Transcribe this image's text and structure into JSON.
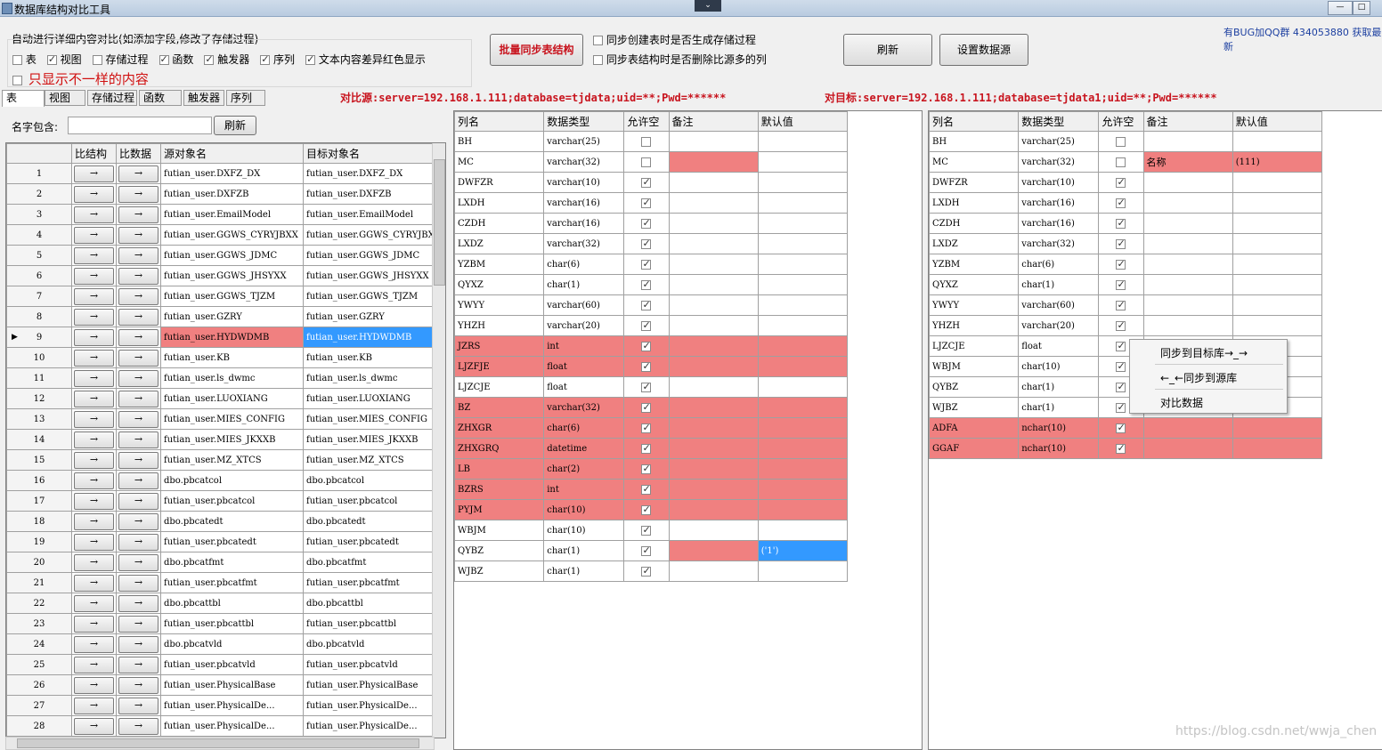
{
  "window": {
    "title": "数据库结构对比工具",
    "collapse_glyph": "⌄"
  },
  "options": {
    "auto_compare_label": "自动进行详细内容对比(如添加字段,修改了存储过程)",
    "checks": [
      {
        "label": "表",
        "checked": false
      },
      {
        "label": "视图",
        "checked": true
      },
      {
        "label": "存储过程",
        "checked": false
      },
      {
        "label": "函数",
        "checked": true
      },
      {
        "label": "触发器",
        "checked": true
      },
      {
        "label": "序列",
        "checked": true
      },
      {
        "label": "文本内容差异红色显示",
        "checked": true
      }
    ],
    "only_diff_label": "只显示不一样的内容",
    "batch_sync_label": "批量同步表结构",
    "sync_create_proc_label": "同步创建表时是否生成存储过程",
    "sync_delete_cols_label": "同步表结构时是否删除比源多的列",
    "refresh_label": "刷新",
    "set_datasource_label": "设置数据源",
    "bug_text": "有BUG加QQ群 434053880 获取最新"
  },
  "tabs": [
    "表",
    "视图",
    "存储过程",
    "函数",
    "触发器",
    "序列"
  ],
  "source_label": "对比源:server=192.168.1.111;database=tjdata;uid=**;Pwd=******",
  "target_label": "对目标:server=192.168.1.111;database=tjdata1;uid=**;Pwd=******",
  "filter": {
    "label": "名字包含:",
    "value": "",
    "refresh_label": "刷新"
  },
  "object_list": {
    "headers": [
      "比结构",
      "比数据",
      "源对象名",
      "目标对象名"
    ],
    "arrow": "→",
    "rows": [
      {
        "n": "1",
        "src": "futian_user.DXFZ_DX",
        "dst": "futian_user.DXFZ_DX"
      },
      {
        "n": "2",
        "src": "futian_user.DXFZB",
        "dst": "futian_user.DXFZB"
      },
      {
        "n": "3",
        "src": "futian_user.EmailModel",
        "dst": "futian_user.EmailModel"
      },
      {
        "n": "4",
        "src": "futian_user.GGWS_CYRYJBXX",
        "dst": "futian_user.GGWS_CYRYJBX"
      },
      {
        "n": "5",
        "src": "futian_user.GGWS_JDMC",
        "dst": "futian_user.GGWS_JDMC"
      },
      {
        "n": "6",
        "src": "futian_user.GGWS_JHSYXX",
        "dst": "futian_user.GGWS_JHSYXX"
      },
      {
        "n": "7",
        "src": "futian_user.GGWS_TJZM",
        "dst": "futian_user.GGWS_TJZM"
      },
      {
        "n": "8",
        "src": "futian_user.GZRY",
        "dst": "futian_user.GZRY"
      },
      {
        "n": "9",
        "src": "futian_user.HYDWDMB",
        "dst": "futian_user.HYDWDMB",
        "selected": true
      },
      {
        "n": "10",
        "src": "futian_user.KB",
        "dst": "futian_user.KB"
      },
      {
        "n": "11",
        "src": "futian_user.ls_dwmc",
        "dst": "futian_user.ls_dwmc"
      },
      {
        "n": "12",
        "src": "futian_user.LUOXIANG",
        "dst": "futian_user.LUOXIANG"
      },
      {
        "n": "13",
        "src": "futian_user.MIES_CONFIG",
        "dst": "futian_user.MIES_CONFIG"
      },
      {
        "n": "14",
        "src": "futian_user.MIES_JKXXB",
        "dst": "futian_user.MIES_JKXXB"
      },
      {
        "n": "15",
        "src": "futian_user.MZ_XTCS",
        "dst": "futian_user.MZ_XTCS"
      },
      {
        "n": "16",
        "src": "dbo.pbcatcol",
        "dst": "dbo.pbcatcol"
      },
      {
        "n": "17",
        "src": "futian_user.pbcatcol",
        "dst": "futian_user.pbcatcol"
      },
      {
        "n": "18",
        "src": "dbo.pbcatedt",
        "dst": "dbo.pbcatedt"
      },
      {
        "n": "19",
        "src": "futian_user.pbcatedt",
        "dst": "futian_user.pbcatedt"
      },
      {
        "n": "20",
        "src": "dbo.pbcatfmt",
        "dst": "dbo.pbcatfmt"
      },
      {
        "n": "21",
        "src": "futian_user.pbcatfmt",
        "dst": "futian_user.pbcatfmt"
      },
      {
        "n": "22",
        "src": "dbo.pbcattbl",
        "dst": "dbo.pbcattbl"
      },
      {
        "n": "23",
        "src": "futian_user.pbcattbl",
        "dst": "futian_user.pbcattbl"
      },
      {
        "n": "24",
        "src": "dbo.pbcatvld",
        "dst": "dbo.pbcatvld"
      },
      {
        "n": "25",
        "src": "futian_user.pbcatvld",
        "dst": "futian_user.pbcatvld"
      },
      {
        "n": "26",
        "src": "futian_user.PhysicalBase",
        "dst": "futian_user.PhysicalBase"
      },
      {
        "n": "27",
        "src": "futian_user.PhysicalDe...",
        "dst": "futian_user.PhysicalDe..."
      },
      {
        "n": "28",
        "src": "futian_user.PhysicalDe...",
        "dst": "futian_user.PhysicalDe..."
      }
    ]
  },
  "column_headers": [
    "列名",
    "数据类型",
    "允许空",
    "备注",
    "默认值"
  ],
  "source_columns": [
    {
      "name": "BH",
      "type": "varchar(25)",
      "nullable": false,
      "note": "",
      "def": ""
    },
    {
      "name": "MC",
      "type": "varchar(32)",
      "nullable": false,
      "note": "",
      "def": "",
      "hl_note": true
    },
    {
      "name": "DWFZR",
      "type": "varchar(10)",
      "nullable": true,
      "note": "",
      "def": ""
    },
    {
      "name": "LXDH",
      "type": "varchar(16)",
      "nullable": true,
      "note": "",
      "def": ""
    },
    {
      "name": "CZDH",
      "type": "varchar(16)",
      "nullable": true,
      "note": "",
      "def": ""
    },
    {
      "name": "LXDZ",
      "type": "varchar(32)",
      "nullable": true,
      "note": "",
      "def": ""
    },
    {
      "name": "YZBM",
      "type": "char(6)",
      "nullable": true,
      "note": "",
      "def": ""
    },
    {
      "name": "QYXZ",
      "type": "char(1)",
      "nullable": true,
      "note": "",
      "def": ""
    },
    {
      "name": "YWYY",
      "type": "varchar(60)",
      "nullable": true,
      "note": "",
      "def": ""
    },
    {
      "name": "YHZH",
      "type": "varchar(20)",
      "nullable": true,
      "note": "",
      "def": ""
    },
    {
      "name": "JZRS",
      "type": "int",
      "nullable": true,
      "note": "",
      "def": "",
      "hl": true
    },
    {
      "name": "LJZFJE",
      "type": "float",
      "nullable": true,
      "note": "",
      "def": "",
      "hl": true
    },
    {
      "name": "LJZCJE",
      "type": "float",
      "nullable": true,
      "note": "",
      "def": ""
    },
    {
      "name": "BZ",
      "type": "varchar(32)",
      "nullable": true,
      "note": "",
      "def": "",
      "hl": true
    },
    {
      "name": "ZHXGR",
      "type": "char(6)",
      "nullable": true,
      "note": "",
      "def": "",
      "hl": true
    },
    {
      "name": "ZHXGRQ",
      "type": "datetime",
      "nullable": true,
      "note": "",
      "def": "",
      "hl": true
    },
    {
      "name": "LB",
      "type": "char(2)",
      "nullable": true,
      "note": "",
      "def": "",
      "hl": true
    },
    {
      "name": "BZRS",
      "type": "int",
      "nullable": true,
      "note": "",
      "def": "",
      "hl": true
    },
    {
      "name": "PYJM",
      "type": "char(10)",
      "nullable": true,
      "note": "",
      "def": "",
      "hl": true
    },
    {
      "name": "WBJM",
      "type": "char(10)",
      "nullable": true,
      "note": "",
      "def": ""
    },
    {
      "name": "QYBZ",
      "type": "char(1)",
      "nullable": true,
      "note": "",
      "def": "('1')",
      "hl_note": true,
      "sel_def": true
    },
    {
      "name": "WJBZ",
      "type": "char(1)",
      "nullable": true,
      "note": "",
      "def": ""
    }
  ],
  "target_columns": [
    {
      "name": "BH",
      "type": "varchar(25)",
      "nullable": false,
      "note": "",
      "def": ""
    },
    {
      "name": "MC",
      "type": "varchar(32)",
      "nullable": false,
      "note": "名称",
      "def": "(111)",
      "hl_note": true,
      "hl_def": true
    },
    {
      "name": "DWFZR",
      "type": "varchar(10)",
      "nullable": true,
      "note": "",
      "def": ""
    },
    {
      "name": "LXDH",
      "type": "varchar(16)",
      "nullable": true,
      "note": "",
      "def": ""
    },
    {
      "name": "CZDH",
      "type": "varchar(16)",
      "nullable": true,
      "note": "",
      "def": ""
    },
    {
      "name": "LXDZ",
      "type": "varchar(32)",
      "nullable": true,
      "note": "",
      "def": ""
    },
    {
      "name": "YZBM",
      "type": "char(6)",
      "nullable": true,
      "note": "",
      "def": ""
    },
    {
      "name": "QYXZ",
      "type": "char(1)",
      "nullable": true,
      "note": "",
      "def": ""
    },
    {
      "name": "YWYY",
      "type": "varchar(60)",
      "nullable": true,
      "note": "",
      "def": ""
    },
    {
      "name": "YHZH",
      "type": "varchar(20)",
      "nullable": true,
      "note": "",
      "def": ""
    },
    {
      "name": "LJZCJE",
      "type": "float",
      "nullable": true,
      "note": "",
      "def": ""
    },
    {
      "name": "WBJM",
      "type": "char(10)",
      "nullable": true,
      "note": "",
      "def": ""
    },
    {
      "name": "QYBZ",
      "type": "char(1)",
      "nullable": true,
      "note": "",
      "def": ""
    },
    {
      "name": "WJBZ",
      "type": "char(1)",
      "nullable": true,
      "note": "",
      "def": ""
    },
    {
      "name": "ADFA",
      "type": "nchar(10)",
      "nullable": true,
      "note": "",
      "def": "",
      "hl": true
    },
    {
      "name": "GGAF",
      "type": "nchar(10)",
      "nullable": true,
      "note": "",
      "def": "",
      "hl": true
    }
  ],
  "context_menu": [
    "同步到目标库→_→",
    "←_←同步到源库",
    "对比数据"
  ],
  "watermark": "https://blog.csdn.net/wwja_chen",
  "colors": {
    "diff_highlight": "#f08080",
    "selection": "#3399ff",
    "emphasis": "#c8141e"
  }
}
